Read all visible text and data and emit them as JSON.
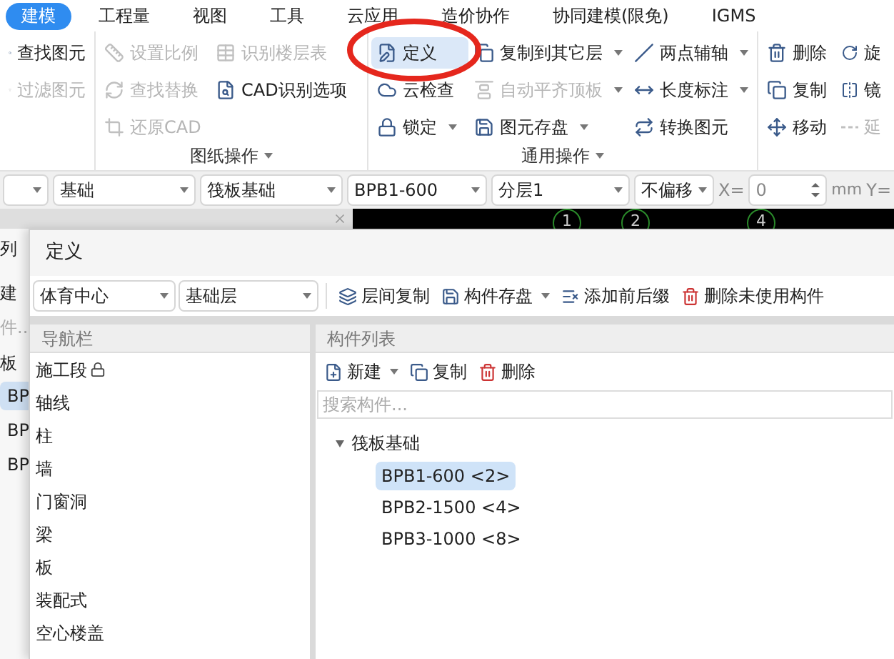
{
  "menu": [
    {
      "label": "建模",
      "selected": true
    },
    {
      "label": "工程量",
      "selected": false
    },
    {
      "label": "视图",
      "selected": false
    },
    {
      "label": "工具",
      "selected": false
    },
    {
      "label": "云应用",
      "selected": false
    },
    {
      "label": "造价协作",
      "selected": false
    },
    {
      "label": "协同建模(限免)",
      "selected": false
    },
    {
      "label": "IGMS",
      "selected": false
    }
  ],
  "ribbon_groups": [
    {
      "columns": [
        [
          {
            "label": "查找图元",
            "disabled": false,
            "dropdown": false,
            "active": false
          },
          {
            "label": "过滤图元",
            "disabled": true,
            "dropdown": false,
            "active": false
          }
        ]
      ]
    },
    {
      "title": "图纸操作",
      "columns": [
        [
          {
            "label": "设置比例",
            "disabled": true,
            "dropdown": false,
            "active": false
          },
          {
            "label": "查找替换",
            "disabled": true,
            "dropdown": false,
            "active": false
          },
          {
            "label": "还原CAD",
            "disabled": true,
            "dropdown": false,
            "active": false
          }
        ],
        [
          {
            "label": "识别楼层表",
            "disabled": true,
            "dropdown": false,
            "active": false
          },
          {
            "label": "CAD识别选项",
            "disabled": false,
            "dropdown": false,
            "active": false
          }
        ]
      ]
    },
    {
      "title": "通用操作",
      "columns": [
        [
          {
            "label": "定义",
            "disabled": false,
            "dropdown": false,
            "active": true
          },
          {
            "label": "云检查",
            "disabled": false,
            "dropdown": false,
            "active": false
          },
          {
            "label": "锁定",
            "disabled": false,
            "dropdown": true,
            "active": false
          }
        ],
        [
          {
            "label": "复制到其它层",
            "disabled": false,
            "dropdown": true,
            "active": false
          },
          {
            "label": "自动平齐顶板",
            "disabled": true,
            "dropdown": true,
            "active": false
          },
          {
            "label": "图元存盘",
            "disabled": false,
            "dropdown": true,
            "active": false
          }
        ],
        [
          {
            "label": "两点辅轴",
            "disabled": false,
            "dropdown": true,
            "active": false
          },
          {
            "label": "长度标注",
            "disabled": false,
            "dropdown": true,
            "active": false
          },
          {
            "label": "转换图元",
            "disabled": false,
            "dropdown": false,
            "active": false
          }
        ]
      ]
    },
    {
      "columns": [
        [
          {
            "label": "删除",
            "disabled": false,
            "dropdown": false,
            "active": false
          },
          {
            "label": "复制",
            "disabled": false,
            "dropdown": false,
            "active": false
          },
          {
            "label": "移动",
            "disabled": false,
            "dropdown": false,
            "active": false
          }
        ],
        [
          {
            "label": "旋",
            "disabled": false,
            "dropdown": false,
            "active": false
          },
          {
            "label": "镜",
            "disabled": false,
            "dropdown": false,
            "active": false
          },
          {
            "label": "延",
            "disabled": true,
            "dropdown": false,
            "active": false
          }
        ]
      ]
    }
  ],
  "property_bar": {
    "leading_empty_combo": true,
    "combos": [
      {
        "value": "基础"
      },
      {
        "value": "筏板基础"
      },
      {
        "value": "BPB1-600"
      },
      {
        "value": "分层1"
      },
      {
        "value": "不偏移"
      }
    ],
    "x_label": "X=",
    "x_value": "0",
    "unit": "mm",
    "y_label": "Y="
  },
  "canvas": {
    "axis_labels": [
      "1",
      "2",
      "4"
    ]
  },
  "back_panel": {
    "header": "列",
    "items": [
      "建",
      "件..",
      "板"
    ],
    "rows": [
      {
        "label": "BP",
        "selected": true
      },
      {
        "label": "BP",
        "selected": false
      },
      {
        "label": "BP",
        "selected": false
      }
    ]
  },
  "dialog": {
    "title": "定义",
    "combos": [
      "体育中心",
      "基础层"
    ],
    "tools": [
      {
        "label": "层间复制",
        "dropdown": false
      },
      {
        "label": "构件存盘",
        "dropdown": true
      },
      {
        "label": "添加前后缀",
        "dropdown": false
      },
      {
        "label": "删除未使用构件",
        "dropdown": false
      }
    ],
    "nav": {
      "header": "导航栏",
      "items": [
        {
          "label": "施工段",
          "locked": true
        },
        {
          "label": "轴线",
          "locked": false
        },
        {
          "label": "柱",
          "locked": false
        },
        {
          "label": "墙",
          "locked": false
        },
        {
          "label": "门窗洞",
          "locked": false
        },
        {
          "label": "梁",
          "locked": false
        },
        {
          "label": "板",
          "locked": false
        },
        {
          "label": "装配式",
          "locked": false
        },
        {
          "label": "空心楼盖",
          "locked": false
        }
      ]
    },
    "components": {
      "header": "构件列表",
      "tools": [
        {
          "label": "新建",
          "dropdown": true
        },
        {
          "label": "复制",
          "dropdown": false
        },
        {
          "label": "删除",
          "dropdown": false
        }
      ],
      "search": {
        "placeholder": "搜索构件..."
      },
      "tree": [
        {
          "label": "筏板基础",
          "expanded": true,
          "children": [
            {
              "label": "BPB1-600 <2>",
              "selected": true
            },
            {
              "label": "BPB2-1500 <4>",
              "selected": false
            },
            {
              "label": "BPB3-1000 <8>",
              "selected": false
            }
          ]
        }
      ]
    }
  }
}
